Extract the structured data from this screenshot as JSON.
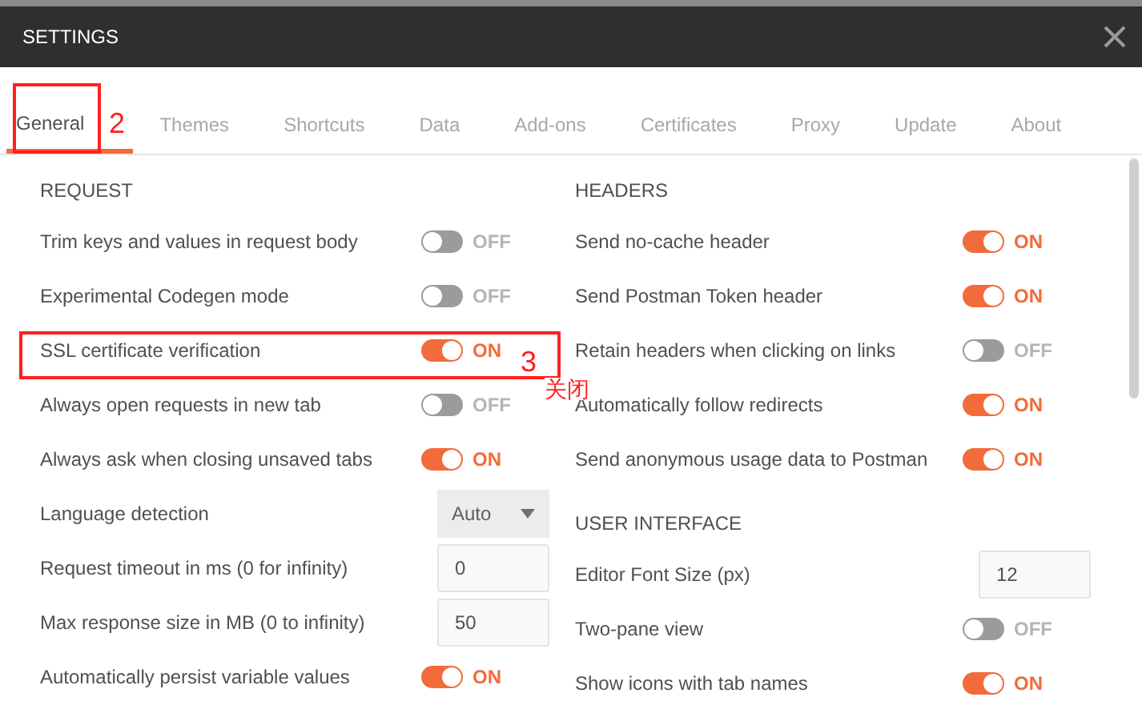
{
  "window": {
    "title": "SETTINGS"
  },
  "tabs": [
    {
      "label": "General",
      "selected": true
    },
    {
      "label": "Themes",
      "selected": false
    },
    {
      "label": "Shortcuts",
      "selected": false
    },
    {
      "label": "Data",
      "selected": false
    },
    {
      "label": "Add-ons",
      "selected": false
    },
    {
      "label": "Certificates",
      "selected": false
    },
    {
      "label": "Proxy",
      "selected": false
    },
    {
      "label": "Update",
      "selected": false
    },
    {
      "label": "About",
      "selected": false
    }
  ],
  "left": [
    {
      "title": "REQUEST",
      "items": [
        {
          "kind": "toggle",
          "label": "Trim keys and values in request body",
          "on": false,
          "state_text": "OFF"
        },
        {
          "kind": "toggle",
          "label": "Experimental Codegen mode",
          "on": false,
          "state_text": "OFF"
        },
        {
          "kind": "toggle",
          "label": "SSL certificate verification",
          "on": true,
          "state_text": "ON"
        },
        {
          "kind": "toggle",
          "label": "Always open requests in new tab",
          "on": false,
          "state_text": "OFF"
        },
        {
          "kind": "toggle",
          "label": "Always ask when closing unsaved tabs",
          "on": true,
          "state_text": "ON"
        },
        {
          "kind": "select",
          "label": "Language detection",
          "value": "Auto"
        },
        {
          "kind": "number",
          "label": "Request timeout in ms (0 for infinity)",
          "value": "0"
        },
        {
          "kind": "number",
          "label": "Max response size in MB (0 to infinity)",
          "value": "50"
        },
        {
          "kind": "toggle",
          "label": "Automatically persist variable values",
          "on": true,
          "state_text": "ON"
        }
      ]
    }
  ],
  "right": [
    {
      "title": "HEADERS",
      "items": [
        {
          "kind": "toggle",
          "label": "Send no-cache header",
          "on": true,
          "state_text": "ON"
        },
        {
          "kind": "toggle",
          "label": "Send Postman Token header",
          "on": true,
          "state_text": "ON"
        },
        {
          "kind": "toggle",
          "label": "Retain headers when clicking on links",
          "on": false,
          "state_text": "OFF"
        },
        {
          "kind": "toggle",
          "label": "Automatically follow redirects",
          "on": true,
          "state_text": "ON"
        },
        {
          "kind": "toggle",
          "label": "Send anonymous usage data to Postman",
          "on": true,
          "state_text": "ON"
        }
      ]
    },
    {
      "title": "USER INTERFACE",
      "items": [
        {
          "kind": "number",
          "label": "Editor Font Size (px)",
          "value": "12"
        },
        {
          "kind": "toggle",
          "label": "Two-pane view",
          "on": false,
          "state_text": "OFF"
        },
        {
          "kind": "toggle",
          "label": "Show icons with tab names",
          "on": true,
          "state_text": "ON"
        }
      ]
    }
  ],
  "annotations": [
    {
      "text": "2"
    },
    {
      "text": "3"
    },
    {
      "text": "关闭"
    }
  ]
}
